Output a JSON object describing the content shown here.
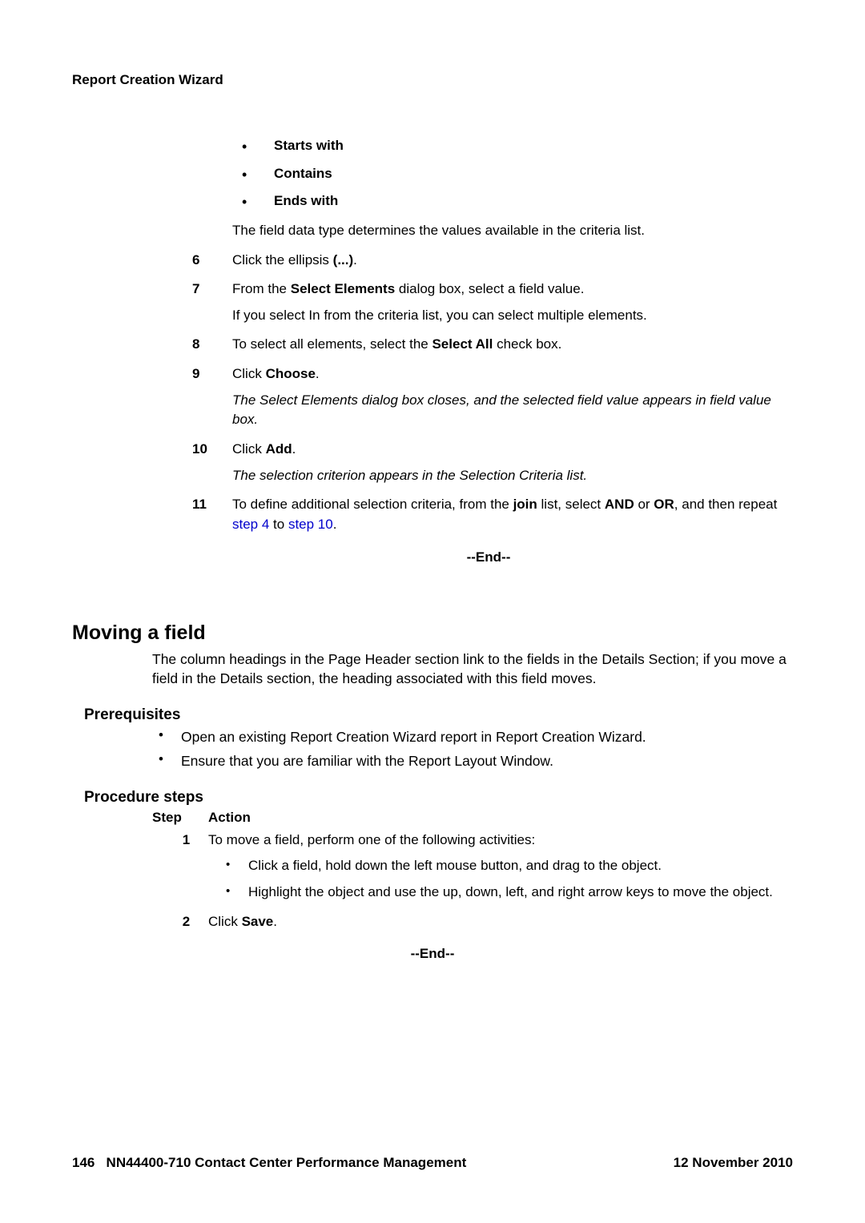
{
  "header": {
    "title": "Report Creation Wizard"
  },
  "top_bullets": [
    "Starts with",
    "Contains",
    "Ends with"
  ],
  "top_note": "The field data type determines the values available in the criteria list.",
  "steps_upper": [
    {
      "num": "6",
      "lines": [
        {
          "t": "Click the ellipsis "
        },
        {
          "t": "(...)",
          "b": true
        },
        {
          "t": "."
        }
      ]
    },
    {
      "num": "7",
      "lines": [
        {
          "t": "From the "
        },
        {
          "t": "Select Elements",
          "b": true
        },
        {
          "t": " dialog box, select a field value."
        }
      ],
      "after": "If you select In from the criteria list, you can select multiple elements."
    },
    {
      "num": "8",
      "lines": [
        {
          "t": "To select all elements, select the "
        },
        {
          "t": "Select All",
          "b": true
        },
        {
          "t": " check box."
        }
      ]
    },
    {
      "num": "9",
      "lines": [
        {
          "t": "Click "
        },
        {
          "t": "Choose",
          "b": true
        },
        {
          "t": "."
        }
      ],
      "after_i": "The Select Elements dialog box closes, and the selected field value appears in field value box."
    },
    {
      "num": "10",
      "lines": [
        {
          "t": "Click "
        },
        {
          "t": "Add",
          "b": true
        },
        {
          "t": "."
        }
      ],
      "after_i": "The selection criterion appears in the Selection Criteria list."
    },
    {
      "num": "11",
      "lines": [
        {
          "t": "To define additional selection criteria, from the "
        },
        {
          "t": "join",
          "b": true
        },
        {
          "t": " list, select "
        },
        {
          "t": "AND",
          "b": true
        },
        {
          "t": " or "
        },
        {
          "t": "OR",
          "b": true
        },
        {
          "t": ", and then repeat "
        },
        {
          "t": "step 4",
          "link": true
        },
        {
          "t": " to "
        },
        {
          "t": "step 10",
          "link": true
        },
        {
          "t": "."
        }
      ]
    }
  ],
  "end_marker": "--End--",
  "section": {
    "h1": "Moving a field",
    "para": "The column headings in the Page Header section link to the fields in the Details Section; if you move a field in the Details section, the heading associated with this field moves.",
    "h2_prereq": "Prerequisites",
    "prereqs": [
      "Open an existing Report Creation Wizard report in Report Creation Wizard.",
      "Ensure that you are familiar with the Report Layout Window."
    ],
    "h2_proc": "Procedure steps",
    "proc_header": {
      "step": "Step",
      "action": "Action"
    },
    "proc": [
      {
        "num": "1",
        "text": "To move a field, perform one of the following activities:",
        "subs": [
          "Click a field, hold down the left mouse button, and drag to the object.",
          "Highlight the object and use the up, down, left, and right arrow keys to move the object."
        ]
      },
      {
        "num": "2",
        "lines": [
          {
            "t": "Click "
          },
          {
            "t": "Save",
            "b": true
          },
          {
            "t": "."
          }
        ]
      }
    ]
  },
  "footer": {
    "page_num": "146",
    "doc_title": "NN44400-710 Contact Center Performance Management",
    "date": "12 November 2010"
  }
}
